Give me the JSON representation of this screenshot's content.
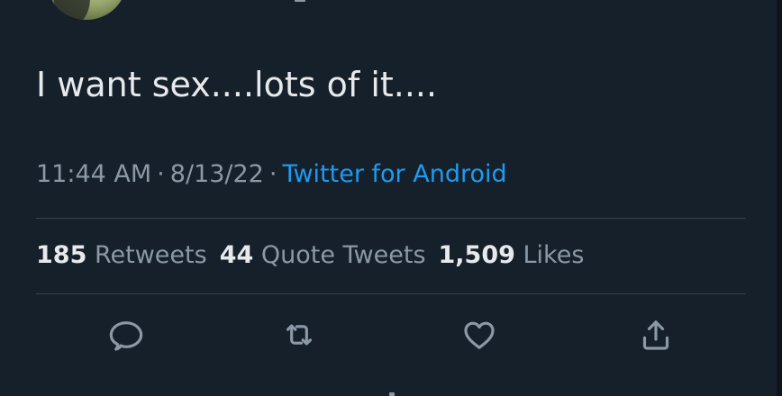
{
  "tweet": {
    "text": "I want sex....lots of it....",
    "time": "11:44 AM",
    "date": "8/13/22",
    "source": "Twitter for Android",
    "separator": "·"
  },
  "stats": {
    "retweets_count": "185",
    "retweets_label": "Retweets",
    "quotes_count": "44",
    "quotes_label": "Quote Tweets",
    "likes_count": "1,509",
    "likes_label": "Likes"
  },
  "actions": {
    "reply_icon": "reply-icon",
    "retweet_icon": "retweet-icon",
    "like_icon": "heart-icon",
    "share_icon": "share-icon"
  },
  "colors": {
    "background": "#15202b",
    "text": "#e7e9ea",
    "secondary_text": "#8b98a5",
    "link": "#1d9bf0",
    "divider": "#38444d"
  }
}
